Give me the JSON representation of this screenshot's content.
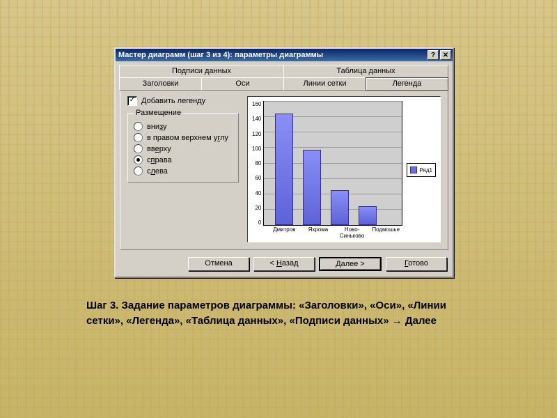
{
  "dialog": {
    "title": "Мастер диаграмм (шаг 3 из 4): параметры диаграммы",
    "help": "?",
    "close": "✕"
  },
  "tabs": {
    "row1": [
      "Подписи данных",
      "Таблица данных"
    ],
    "row2": [
      "Заголовки",
      "Оси",
      "Линии сетки",
      "Легенда"
    ],
    "active": "Легенда"
  },
  "options": {
    "add_legend": "Добавить легенду",
    "placement_label": "Размещение",
    "radios": [
      {
        "key": "bottom",
        "label_pre": "вни",
        "label_u": "з",
        "label_post": "у",
        "selected": false
      },
      {
        "key": "top-right",
        "label_pre": "в правом верхнем у",
        "label_u": "г",
        "label_post": "лу",
        "selected": false
      },
      {
        "key": "top",
        "label_pre": "вв",
        "label_u": "е",
        "label_post": "рху",
        "selected": false
      },
      {
        "key": "right",
        "label_pre": "с",
        "label_u": "п",
        "label_post": "рава",
        "selected": true
      },
      {
        "key": "left",
        "label_pre": "с",
        "label_u": "л",
        "label_post": "ева",
        "selected": false
      }
    ]
  },
  "chart_data": {
    "type": "bar",
    "categories": [
      "Дмитров",
      "Яхрома",
      "Ново-\nСиньково",
      "Подмошье"
    ],
    "values": [
      145,
      98,
      45,
      25
    ],
    "series_name": "Ряд1",
    "ylabel": "",
    "xlabel": "",
    "ylim": [
      0,
      160
    ],
    "yticks": [
      0,
      20,
      40,
      60,
      80,
      100,
      120,
      140,
      160
    ]
  },
  "legend_entry": "Ряд1",
  "buttons": {
    "cancel": "Отмена",
    "back_pre": "< ",
    "back_u": "Н",
    "back_post": "азад",
    "next_pre": "",
    "next_u": "Д",
    "next_post": "алее >",
    "finish_u": "Г",
    "finish_post": "отово"
  },
  "caption": "Шаг 3. Задание параметров диаграммы: «Заголовки», «Оси», «Линии сетки», «Легенда», «Таблица данных»,  «Подписи данных» → Далее"
}
